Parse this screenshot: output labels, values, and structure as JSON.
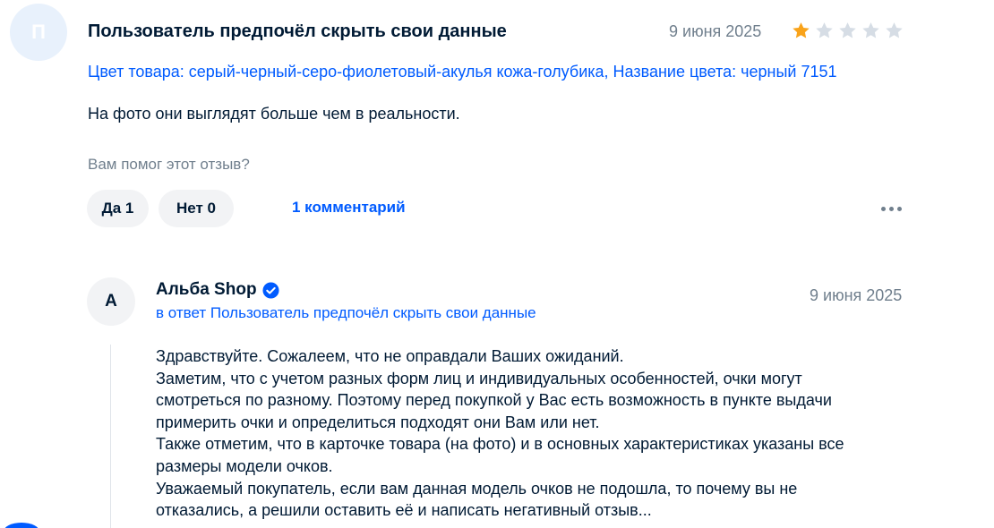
{
  "review": {
    "avatar_letter": "П",
    "author": "Пользователь предпочёл скрыть свои данные",
    "date": "9 июня 2025",
    "rating": 1,
    "rating_max": 5,
    "product_info": "Цвет товара: серый-черный-серо-фиолетовый-акулья кожа-голубика, Название цвета: черный 7151",
    "text": "На фото они выглядят больше чем в реальности.",
    "helpful_question": "Вам помог этот отзыв?",
    "yes_label": "Да 1",
    "no_label": "Нет 0",
    "comments_label": "1 комментарий"
  },
  "reply": {
    "avatar_letter": "А",
    "shop_name": "Альба Shop",
    "date": "9 июня 2025",
    "in_reply_to": "в ответ Пользователь предпочёл скрыть свои данные",
    "lines": [
      "Здравствуйте. Сожалеем, что не оправдали Ваших ожиданий.",
      "Заметим, что с учетом разных форм лиц и индивидуальных особенностей, очки могут",
      "смотреться по разному. Поэтому перед покупкой у Вас есть возможность в пункте выдачи",
      "примерить очки и определиться подходят они Вам или нет.",
      "Также отметим, что в карточке товара (на фото) и в основных характеристиках указаны все",
      "размеры модели очков.",
      "Уважаемый покупатель, если вам данная модель очков не подошла, то почему вы не",
      "отказались, а решили оставить её и написать негативный отзыв..."
    ]
  },
  "colors": {
    "star_filled": "#f9a31a",
    "star_empty": "#d6dde5",
    "link": "#005bff",
    "secondary_text": "#707f8d"
  }
}
